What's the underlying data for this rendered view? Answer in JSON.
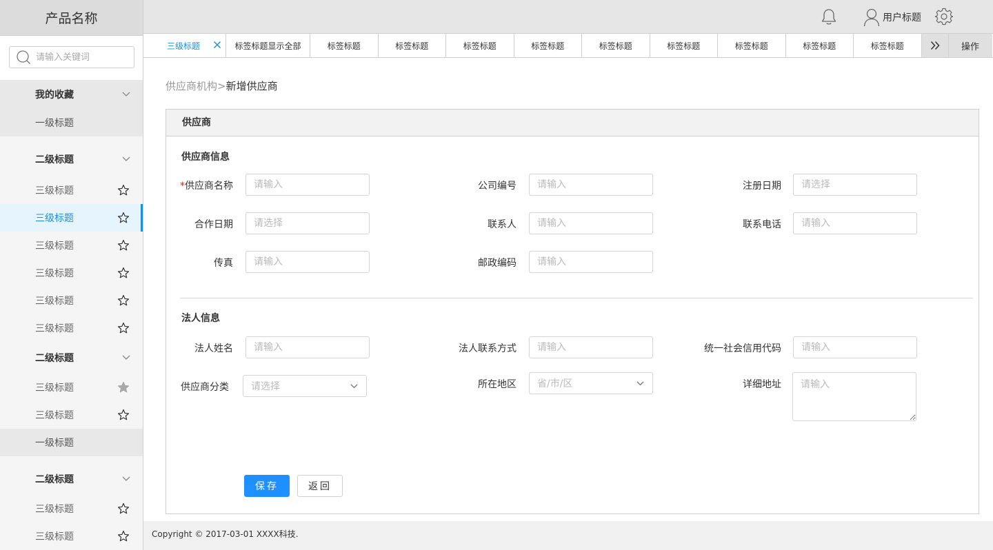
{
  "sidebar": {
    "product_name": "产品名称",
    "search_placeholder": "请输入关键词",
    "items": [
      {
        "label": "我的收藏"
      },
      {
        "label": "一级标题"
      },
      {
        "label": "二级标题"
      },
      {
        "label": "三级标题"
      },
      {
        "label": "三级标题"
      },
      {
        "label": "三级标题"
      },
      {
        "label": "三级标题"
      },
      {
        "label": "三级标题"
      },
      {
        "label": "三级标题"
      },
      {
        "label": "二级标题"
      },
      {
        "label": "三级标题"
      },
      {
        "label": "三级标题"
      },
      {
        "label": "一级标题"
      },
      {
        "label": "二级标题"
      },
      {
        "label": "三级标题"
      },
      {
        "label": "三级标题"
      }
    ]
  },
  "header": {
    "user_name": "用户标题"
  },
  "tabs": {
    "items": [
      "三级标题",
      "标签标题显示全部",
      "标签标题",
      "标签标题",
      "标签标题",
      "标签标题",
      "标签标题",
      "标签标题",
      "标签标题",
      "标签标题",
      "标签标题"
    ],
    "ops_label": "操作"
  },
  "breadcrumb": {
    "parent": "供应商机构",
    "separator": ">",
    "current": "新增供应商"
  },
  "form": {
    "panel_title": "供应商",
    "section1_title": "供应商信息",
    "section2_title": "法人信息",
    "required_mark": "*",
    "fields": {
      "supplier_name": {
        "label": "供应商名称",
        "placeholder": "请输入"
      },
      "company_code": {
        "label": "公司编号",
        "placeholder": "请输入"
      },
      "register_date": {
        "label": "注册日期",
        "placeholder": "请选择"
      },
      "coop_date": {
        "label": "合作日期",
        "placeholder": "请选择"
      },
      "contact": {
        "label": "联系人",
        "placeholder": "请输入"
      },
      "contact_phone": {
        "label": "联系电话",
        "placeholder": "请输入"
      },
      "fax": {
        "label": "传真",
        "placeholder": "请输入"
      },
      "postcode": {
        "label": "邮政编码",
        "placeholder": "请输入"
      },
      "legal_name": {
        "label": "法人姓名",
        "placeholder": "请输入"
      },
      "legal_contact": {
        "label": "法人联系方式",
        "placeholder": "请输入"
      },
      "credit_code": {
        "label": "统一社会信用代码",
        "placeholder": "请输入"
      },
      "category": {
        "label": "供应商分类",
        "placeholder": "请选择"
      },
      "region": {
        "label": "所在地区",
        "placeholder": "省/市/区"
      },
      "address": {
        "label": "详细地址",
        "placeholder": "请输入"
      }
    },
    "save_label": "保存",
    "back_label": "返回"
  },
  "footer": {
    "copyright": "Copyright © 2017-03-01 XXXX科技."
  },
  "colors": {
    "accent": "#1e90ff",
    "active_text": "#1e90d8",
    "required": "#e02020"
  }
}
